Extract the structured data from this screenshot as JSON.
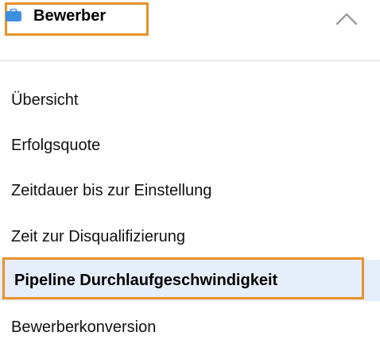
{
  "header": {
    "icon": "briefcase-icon",
    "icon_color": "#3d8fe0",
    "title": "Bewerber",
    "toggle_icon": "chevron-up-icon",
    "highlight_color": "#e8922c"
  },
  "nav": {
    "items": [
      {
        "label": "Übersicht",
        "active": false
      },
      {
        "label": "Erfolgsquote",
        "active": false
      },
      {
        "label": "Zeitdauer bis zur Einstellung",
        "active": false
      },
      {
        "label": "Zeit zur Disqualifizierung",
        "active": false
      },
      {
        "label": "Pipeline Durchlaufgeschwindigkeit",
        "active": true
      },
      {
        "label": "Bewerberkonversion",
        "active": false
      }
    ],
    "active_background": "#e6eefb"
  }
}
